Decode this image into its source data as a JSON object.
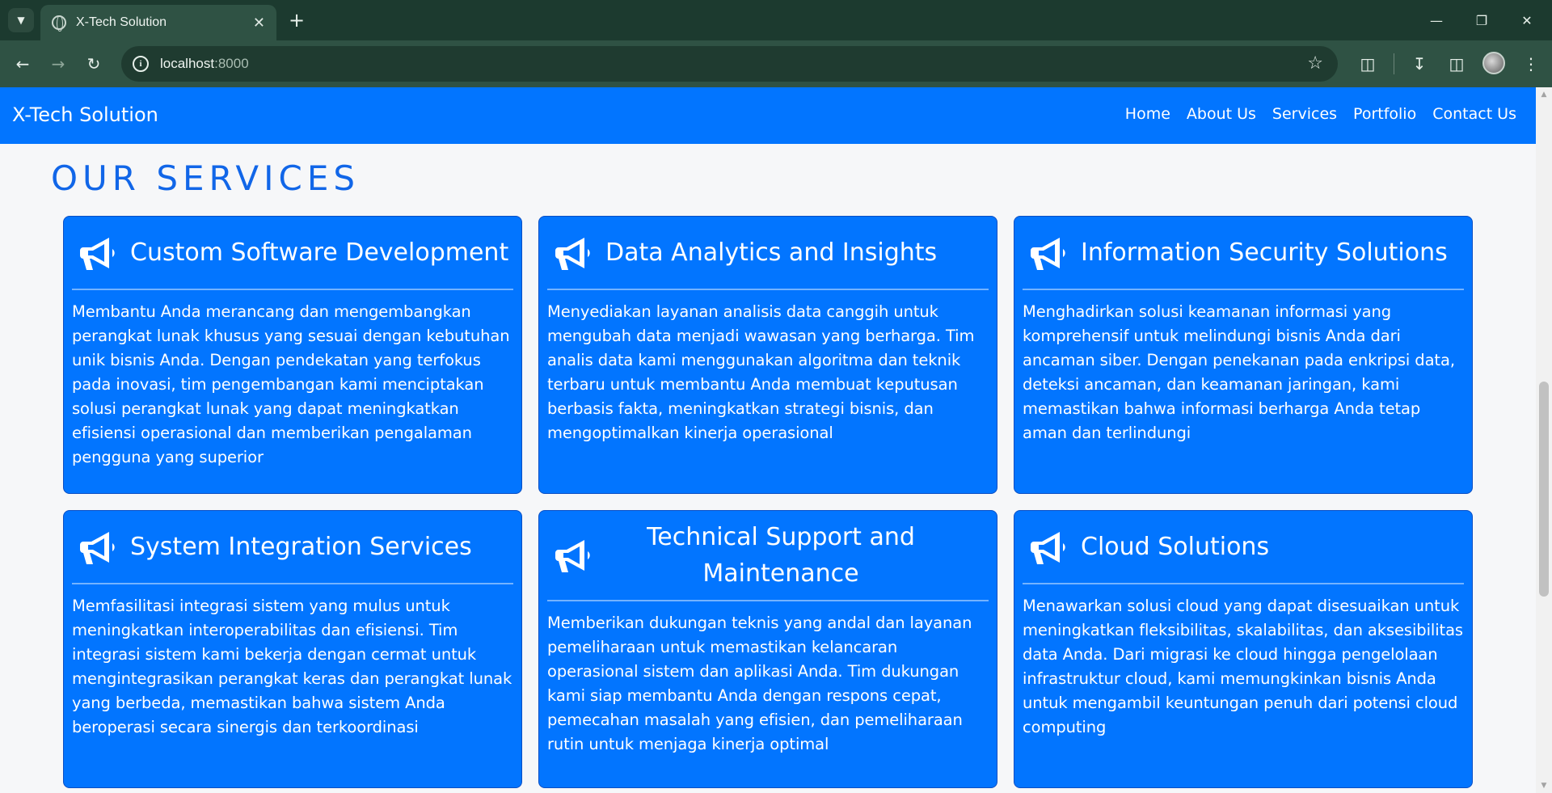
{
  "browser": {
    "tab_title": "X-Tech Solution",
    "url_host": "localhost",
    "url_port": ":8000"
  },
  "navbar": {
    "brand": "X-Tech Solution",
    "links": [
      "Home",
      "About Us",
      "Services",
      "Portfolio",
      "Contact Us"
    ]
  },
  "section_title": "OUR SERVICES",
  "services": [
    {
      "title": "Custom Software Development",
      "description": "Membantu Anda merancang dan mengembangkan perangkat lunak khusus yang sesuai dengan kebutuhan unik bisnis Anda. Dengan pendekatan yang terfokus pada inovasi, tim pengembangan kami menciptakan solusi perangkat lunak yang dapat meningkatkan efisiensi operasional dan memberikan pengalaman pengguna yang superior"
    },
    {
      "title": "Data Analytics and Insights",
      "description": "Menyediakan layanan analisis data canggih untuk mengubah data menjadi wawasan yang berharga. Tim analis data kami menggunakan algoritma dan teknik terbaru untuk membantu Anda membuat keputusan berbasis fakta, meningkatkan strategi bisnis, dan mengoptimalkan kinerja operasional"
    },
    {
      "title": "Information Security Solutions",
      "description": "Menghadirkan solusi keamanan informasi yang komprehensif untuk melindungi bisnis Anda dari ancaman siber. Dengan penekanan pada enkripsi data, deteksi ancaman, dan keamanan jaringan, kami memastikan bahwa informasi berharga Anda tetap aman dan terlindungi"
    },
    {
      "title": "System Integration Services",
      "description": "Memfasilitasi integrasi sistem yang mulus untuk meningkatkan interoperabilitas dan efisiensi. Tim integrasi sistem kami bekerja dengan cermat untuk mengintegrasikan perangkat keras dan perangkat lunak yang berbeda, memastikan bahwa sistem Anda beroperasi secara sinergis dan terkoordinasi"
    },
    {
      "title": "Technical Support and Maintenance",
      "description": "Memberikan dukungan teknis yang andal dan layanan pemeliharaan untuk memastikan kelancaran operasional sistem dan aplikasi Anda. Tim dukungan kami siap membantu Anda dengan respons cepat, pemecahan masalah yang efisien, dan pemeliharaan rutin untuk menjaga kinerja optimal"
    },
    {
      "title": "Cloud Solutions",
      "description": "Menawarkan solusi cloud yang dapat disesuaikan untuk meningkatkan fleksibilitas, skalabilitas, dan aksesibilitas data Anda. Dari migrasi ke cloud hingga pengelolaan infrastruktur cloud, kami memungkinkan bisnis Anda untuk mengambil keuntungan penuh dari potensi cloud computing"
    }
  ],
  "icons": {
    "service_icon": "megaphone-icon"
  },
  "colors": {
    "primary": "#0275ff",
    "title": "#1166e8",
    "page_bg": "#f6f7f9",
    "browser_frame": "#1c3a2f"
  }
}
